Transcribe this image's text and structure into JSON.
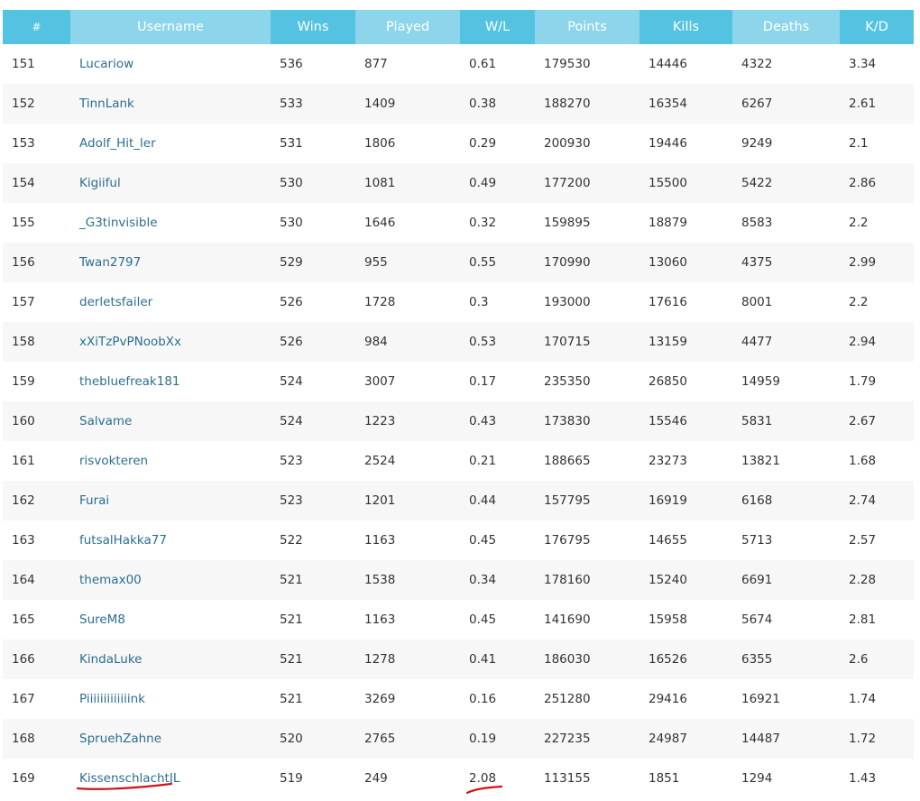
{
  "columns": [
    "#",
    "Username",
    "Wins",
    "Played",
    "W/L",
    "Points",
    "Kills",
    "Deaths",
    "K/D"
  ],
  "rows": [
    [
      "151",
      "Lucariow",
      "536",
      "877",
      "0.61",
      "179530",
      "14446",
      "4322",
      "3.34"
    ],
    [
      "152",
      "TinnLank",
      "533",
      "1409",
      "0.38",
      "188270",
      "16354",
      "6267",
      "2.61"
    ],
    [
      "153",
      "Adolf_Hit_ler",
      "531",
      "1806",
      "0.29",
      "200930",
      "19446",
      "9249",
      "2.1"
    ],
    [
      "154",
      "Kigiiful",
      "530",
      "1081",
      "0.49",
      "177200",
      "15500",
      "5422",
      "2.86"
    ],
    [
      "155",
      "_G3tinvisible",
      "530",
      "1646",
      "0.32",
      "159895",
      "18879",
      "8583",
      "2.2"
    ],
    [
      "156",
      "Twan2797",
      "529",
      "955",
      "0.55",
      "170990",
      "13060",
      "4375",
      "2.99"
    ],
    [
      "157",
      "derletsfailer",
      "526",
      "1728",
      "0.3",
      "193000",
      "17616",
      "8001",
      "2.2"
    ],
    [
      "158",
      "xXiTzPvPNoobXx",
      "526",
      "984",
      "0.53",
      "170715",
      "13159",
      "4477",
      "2.94"
    ],
    [
      "159",
      "thebluefreak181",
      "524",
      "3007",
      "0.17",
      "235350",
      "26850",
      "14959",
      "1.79"
    ],
    [
      "160",
      "Salvame",
      "524",
      "1223",
      "0.43",
      "173830",
      "15546",
      "5831",
      "2.67"
    ],
    [
      "161",
      "risvokteren",
      "523",
      "2524",
      "0.21",
      "188665",
      "23273",
      "13821",
      "1.68"
    ],
    [
      "162",
      "Furai",
      "523",
      "1201",
      "0.44",
      "157795",
      "16919",
      "6168",
      "2.74"
    ],
    [
      "163",
      "futsalHakka77",
      "522",
      "1163",
      "0.45",
      "176795",
      "14655",
      "5713",
      "2.57"
    ],
    [
      "164",
      "themax00",
      "521",
      "1538",
      "0.34",
      "178160",
      "15240",
      "6691",
      "2.28"
    ],
    [
      "165",
      "SureM8",
      "521",
      "1163",
      "0.45",
      "141690",
      "15958",
      "5674",
      "2.81"
    ],
    [
      "166",
      "KindaLuke",
      "521",
      "1278",
      "0.41",
      "186030",
      "16526",
      "6355",
      "2.6"
    ],
    [
      "167",
      "Piiiiiiiiiiiiink",
      "521",
      "3269",
      "0.16",
      "251280",
      "29416",
      "16921",
      "1.74"
    ],
    [
      "168",
      "SpruehZahne",
      "520",
      "2765",
      "0.19",
      "227235",
      "24987",
      "14487",
      "1.72"
    ],
    [
      "169",
      "KissenschlachtJL",
      "519",
      "249",
      "2.08",
      "113155",
      "1851",
      "1294",
      "1.43"
    ]
  ],
  "colors": {
    "header_dark": "#54c3e2",
    "header_light": "#8cd5ea",
    "link": "#2a6f8f",
    "annotation": "#d0121b"
  }
}
